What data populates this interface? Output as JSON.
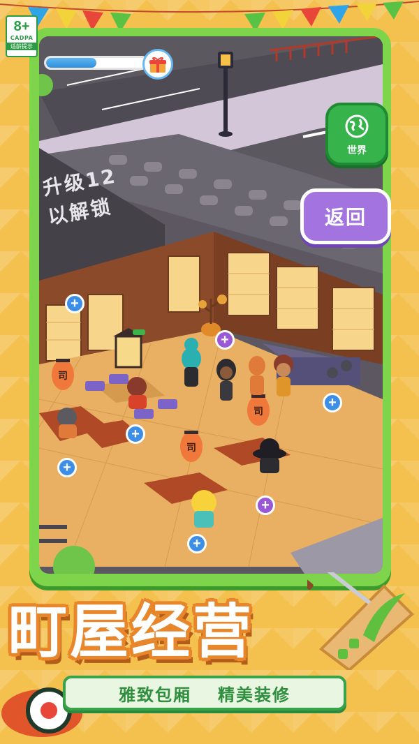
{
  "age_badge": {
    "rating": "8+",
    "org": "CADPA",
    "tip": "适龄提示"
  },
  "hud": {
    "progress": 0.5,
    "gift_icon": "gift-icon"
  },
  "world_button": {
    "label": "世界",
    "icon": "globe-icon"
  },
  "back_button": {
    "label": "返回"
  },
  "locked_area": {
    "line1": "升级12",
    "line2": "以解锁"
  },
  "lantern_text": "司",
  "title": "町屋经营",
  "banner": {
    "left": "雅致包厢",
    "right": "精美装修"
  },
  "colors": {
    "frame": "#7ed44a",
    "world": "#36b34a",
    "back": "#a374e0",
    "title_outline": "#e8862b",
    "banner_text": "#2f8f3f"
  }
}
